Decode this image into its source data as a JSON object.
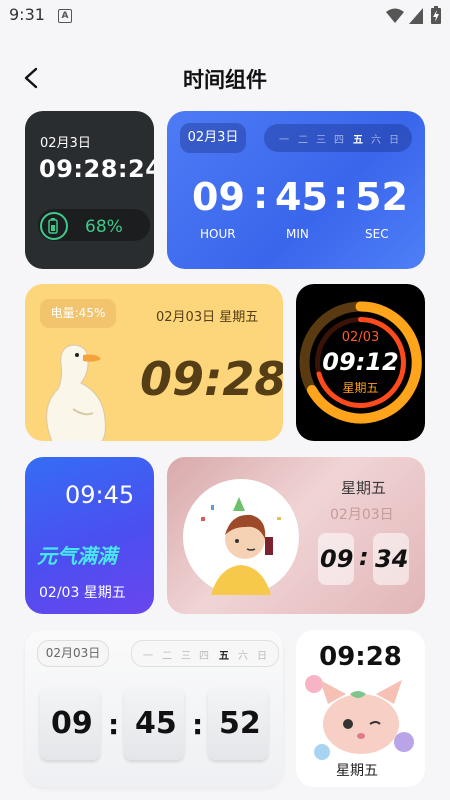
{
  "status_bar": {
    "time": "9:31",
    "notif_icon": "A"
  },
  "header": {
    "title": "时间组件"
  },
  "widget1": {
    "date": "02月3日",
    "time": "09:28:24",
    "battery": "68%"
  },
  "widget2": {
    "date": "02月3日",
    "weekdays": [
      "一",
      "二",
      "三",
      "四",
      "五",
      "六",
      "日"
    ],
    "active_day": "五",
    "hour": "09",
    "minute": "45",
    "second": "52",
    "hour_label": "HOUR",
    "min_label": "MIN",
    "sec_label": "SEC",
    "sep": ":"
  },
  "widget3": {
    "battery": "电量:45%",
    "date": "02月03日 星期五",
    "time": "09:28"
  },
  "widget4": {
    "date": "02/03",
    "time": "09:12",
    "weekday": "星期五"
  },
  "widget5": {
    "time": "09:45",
    "slogan": "元气满满",
    "date": "02/03 星期五"
  },
  "widget6": {
    "weekday": "星期五",
    "date": "02月03日",
    "hour": "09",
    "minute": "34",
    "sep": ":"
  },
  "widget7": {
    "date": "02月03日",
    "weekdays": [
      "一",
      "二",
      "三",
      "四",
      "五",
      "六",
      "日"
    ],
    "active_day": "五",
    "hour": "09",
    "minute": "45",
    "second": "52",
    "sep": ":"
  },
  "widget8": {
    "time": "09:28",
    "weekday": "星期五"
  }
}
